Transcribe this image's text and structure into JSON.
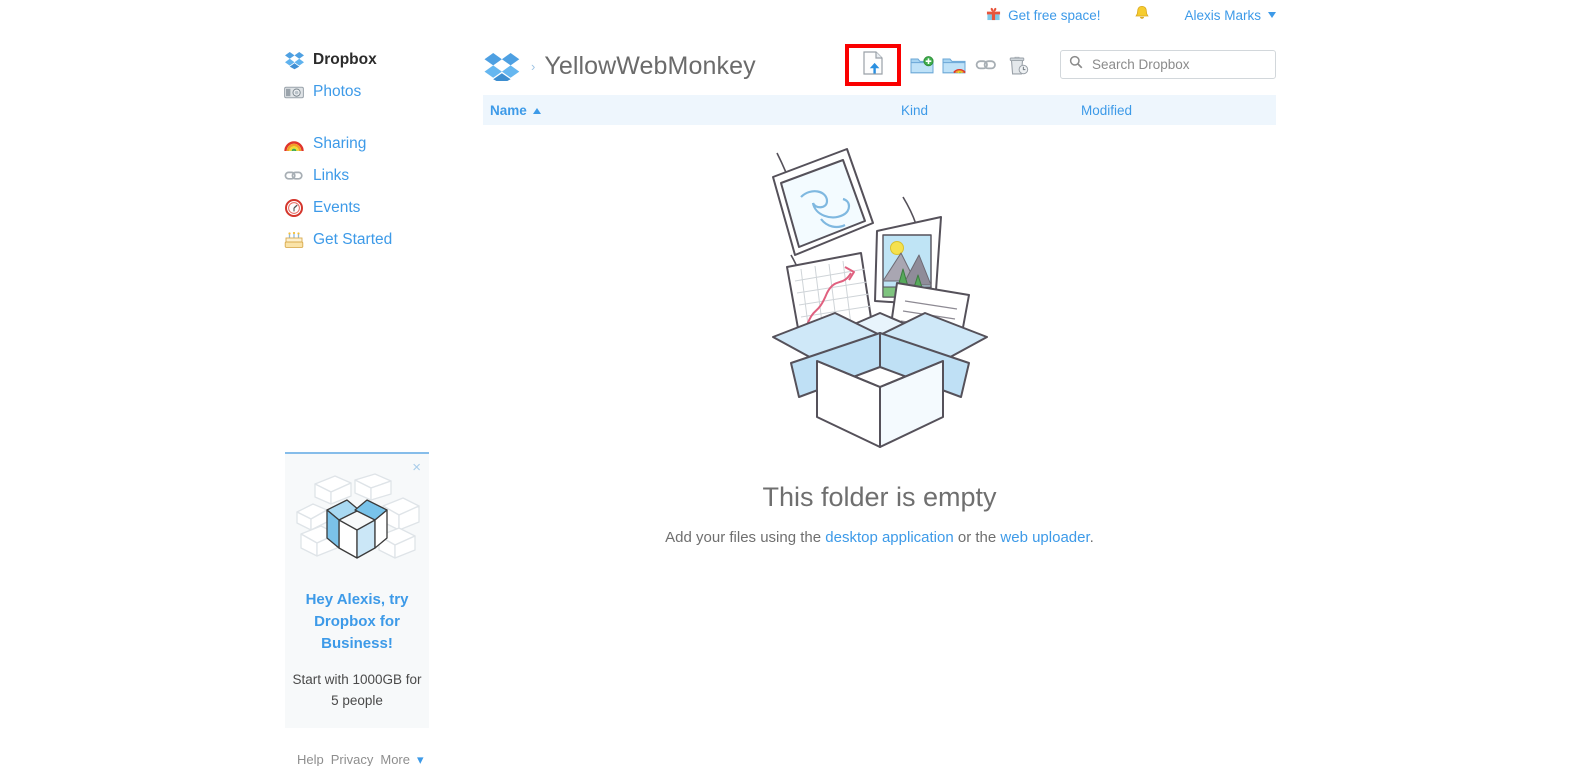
{
  "topbar": {
    "free_space_label": "Get free space!",
    "gift_icon": "gift-icon",
    "bell_icon": "bell-icon",
    "account_name": "Alexis Marks"
  },
  "sidebar": {
    "items": [
      {
        "label": "Dropbox",
        "icon": "dropbox-logo-icon",
        "active": true
      },
      {
        "label": "Photos",
        "icon": "camera-icon",
        "active": false
      },
      {
        "label": "Sharing",
        "icon": "rainbow-icon",
        "active": false
      },
      {
        "label": "Links",
        "icon": "chain-link-icon",
        "active": false
      },
      {
        "label": "Events",
        "icon": "clock-icon",
        "active": false
      },
      {
        "label": "Get Started",
        "icon": "birthday-cake-icon",
        "active": false
      }
    ]
  },
  "breadcrumb": {
    "separator": "›",
    "folder_name": "YellowWebMonkey"
  },
  "toolbar": {
    "upload_label": "Upload file",
    "new_folder_label": "New folder",
    "new_shared_folder_label": "New shared folder",
    "share_link_label": "Share link",
    "delete_label": "Delete",
    "highlight_color": "#fa0000"
  },
  "search": {
    "placeholder": "Search Dropbox",
    "value": ""
  },
  "table": {
    "columns": [
      {
        "label": "Name",
        "sorted": "asc"
      },
      {
        "label": "Kind",
        "sorted": ""
      },
      {
        "label": "Modified",
        "sorted": ""
      }
    ],
    "rows": []
  },
  "empty_state": {
    "title": "This folder is empty",
    "text_before": "Add your files using the ",
    "link_desktop": "desktop application",
    "text_middle": " or the ",
    "link_web": "web uploader",
    "text_after": "."
  },
  "promo": {
    "close_label": "×",
    "headline": "Hey Alexis, try Dropbox for Business!",
    "subtext": "Start with 1000GB for 5 people"
  },
  "footer": {
    "help": "Help",
    "privacy": "Privacy",
    "more": "More",
    "more_caret": "▾"
  },
  "colors": {
    "link_blue": "#3d9ae8",
    "header_bg": "#eef6fd",
    "text_gray": "#6f6f6f",
    "highlight_red": "#fa0000"
  }
}
